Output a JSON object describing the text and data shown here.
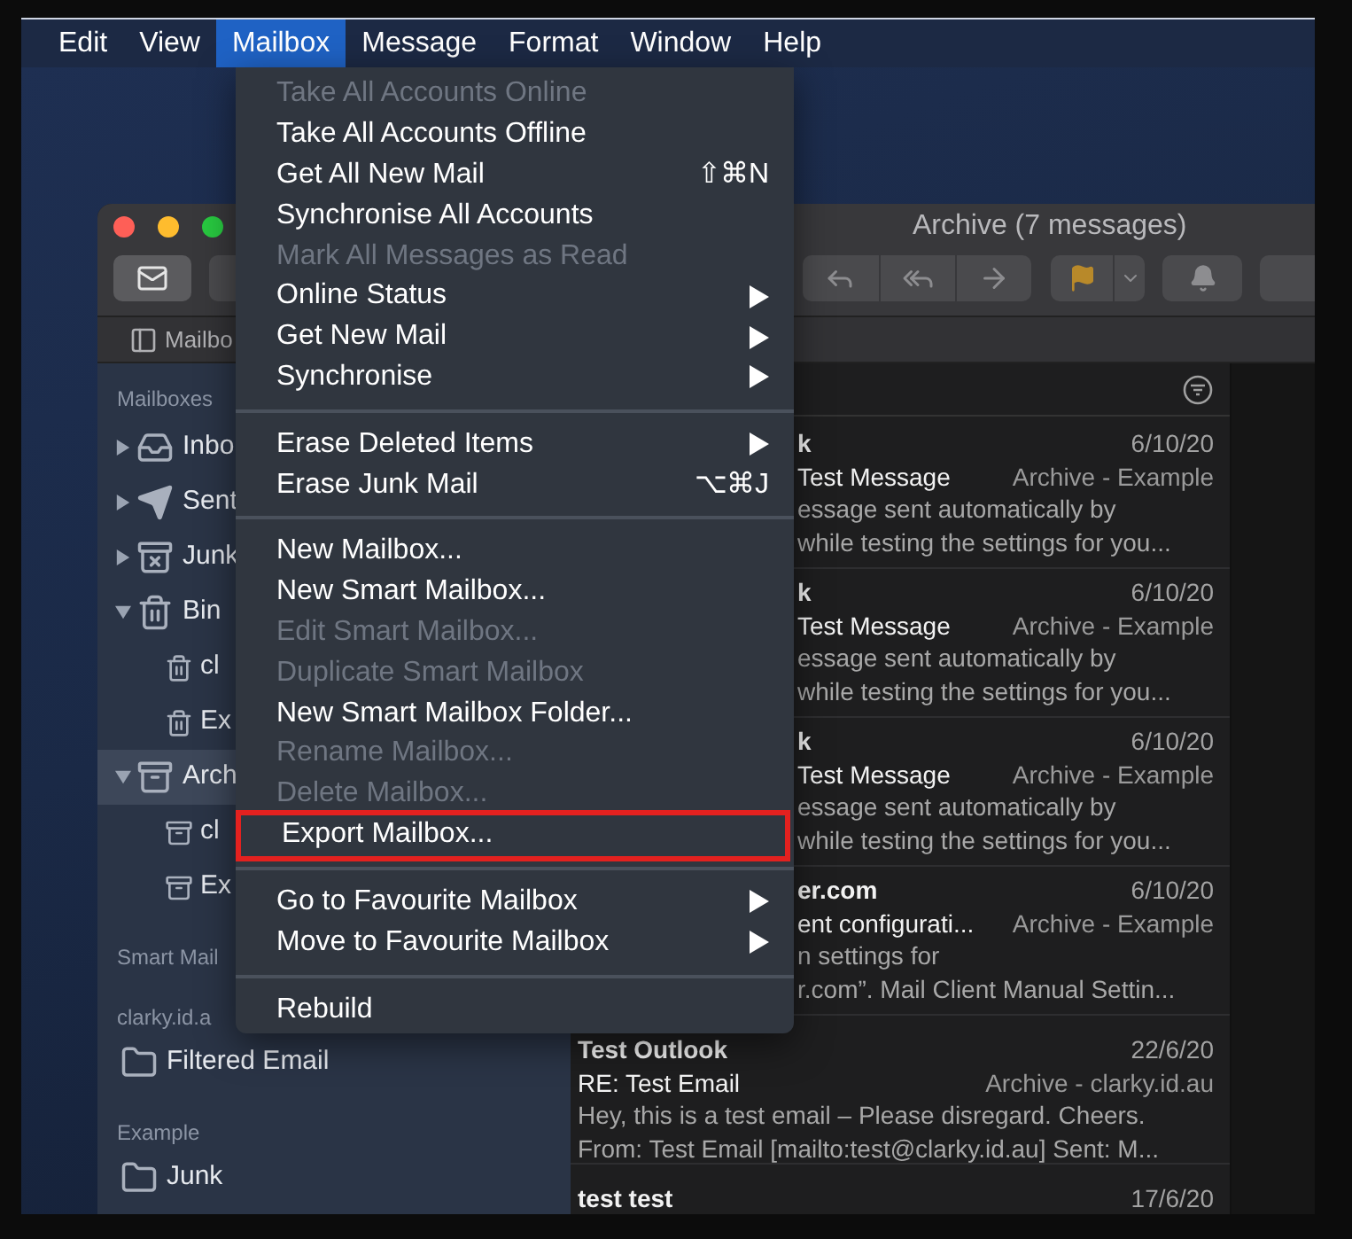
{
  "menu_bar": [
    {
      "label": "Edit",
      "selected": false
    },
    {
      "label": "View",
      "selected": false
    },
    {
      "label": "Mailbox",
      "selected": true
    },
    {
      "label": "Message",
      "selected": false
    },
    {
      "label": "Format",
      "selected": false
    },
    {
      "label": "Window",
      "selected": false
    },
    {
      "label": "Help",
      "selected": false
    }
  ],
  "open_menu": {
    "items": [
      {
        "kind": "item",
        "label": "Take All Accounts Online",
        "disabled": true,
        "submenu": false,
        "highlighted": false
      },
      {
        "kind": "item",
        "label": "Take All Accounts Offline",
        "disabled": false,
        "submenu": false,
        "highlighted": false
      },
      {
        "kind": "item",
        "label": "Get All New Mail",
        "shortcut": "⇧⌘N",
        "disabled": false,
        "submenu": false,
        "highlighted": false
      },
      {
        "kind": "item",
        "label": "Synchronise All Accounts",
        "disabled": false,
        "submenu": false,
        "highlighted": false
      },
      {
        "kind": "item",
        "label": "Mark All Messages as Read",
        "disabled": true,
        "submenu": false,
        "highlighted": false
      },
      {
        "kind": "item",
        "label": "Online Status",
        "disabled": false,
        "submenu": true,
        "highlighted": false
      },
      {
        "kind": "item",
        "label": "Get New Mail",
        "disabled": false,
        "submenu": true,
        "highlighted": false
      },
      {
        "kind": "item",
        "label": "Synchronise",
        "disabled": false,
        "submenu": true,
        "highlighted": false
      },
      {
        "kind": "separator"
      },
      {
        "kind": "item",
        "label": "Erase Deleted Items",
        "disabled": false,
        "submenu": true,
        "highlighted": false
      },
      {
        "kind": "item",
        "label": "Erase Junk Mail",
        "shortcut": "⌥⌘J",
        "disabled": false,
        "submenu": false,
        "highlighted": false
      },
      {
        "kind": "separator"
      },
      {
        "kind": "item",
        "label": "New Mailbox...",
        "disabled": false,
        "submenu": false,
        "highlighted": false
      },
      {
        "kind": "item",
        "label": "New Smart Mailbox...",
        "disabled": false,
        "submenu": false,
        "highlighted": false
      },
      {
        "kind": "item",
        "label": "Edit Smart Mailbox...",
        "disabled": true,
        "submenu": false,
        "highlighted": false
      },
      {
        "kind": "item",
        "label": "Duplicate Smart Mailbox",
        "disabled": true,
        "submenu": false,
        "highlighted": false
      },
      {
        "kind": "item",
        "label": "New Smart Mailbox Folder...",
        "disabled": false,
        "submenu": false,
        "highlighted": false
      },
      {
        "kind": "item",
        "label": "Rename Mailbox...",
        "disabled": true,
        "submenu": false,
        "highlighted": false
      },
      {
        "kind": "item",
        "label": "Delete Mailbox...",
        "disabled": true,
        "submenu": false,
        "highlighted": false
      },
      {
        "kind": "item",
        "label": "Export Mailbox...",
        "disabled": false,
        "submenu": false,
        "highlighted": true
      },
      {
        "kind": "separator"
      },
      {
        "kind": "item",
        "label": "Go to Favourite Mailbox",
        "disabled": false,
        "submenu": true,
        "highlighted": false
      },
      {
        "kind": "item",
        "label": "Move to Favourite Mailbox",
        "disabled": false,
        "submenu": true,
        "highlighted": false
      },
      {
        "kind": "separator"
      },
      {
        "kind": "item",
        "label": "Rebuild",
        "disabled": false,
        "submenu": false,
        "highlighted": false
      }
    ]
  },
  "window": {
    "title": "Archive (7 messages)",
    "favorites_bar": "Mailbo"
  },
  "sidebar": {
    "sections": [
      {
        "header": "Mailboxes",
        "items": [
          {
            "label": "Inbo",
            "kind": "inbox",
            "expanded": false,
            "selected": false
          },
          {
            "label": "Sent",
            "kind": "sent",
            "expanded": false,
            "selected": false
          },
          {
            "label": "Junk",
            "kind": "junk",
            "expanded": false,
            "selected": false
          },
          {
            "label": "Bin",
            "kind": "bin",
            "expanded": true,
            "selected": false,
            "children": [
              {
                "label": "cl",
                "kind": "bin",
                "selected": false
              },
              {
                "label": "Ex",
                "kind": "bin",
                "selected": false
              }
            ]
          },
          {
            "label": "Arch",
            "kind": "archive",
            "expanded": true,
            "selected": true,
            "children": [
              {
                "label": "cl",
                "kind": "archive",
                "selected": false
              },
              {
                "label": "Ex",
                "kind": "archive",
                "selected": false
              }
            ]
          }
        ]
      },
      {
        "header": "Smart Mail"
      },
      {
        "header": "clarky.id.a",
        "items": [
          {
            "label": "Filtered Email",
            "kind": "folder",
            "selected": false
          }
        ]
      },
      {
        "header": "Example",
        "items": [
          {
            "label": "Junk",
            "kind": "folder",
            "selected": false
          }
        ]
      }
    ]
  },
  "message_list": {
    "partly_hidden_rows": [
      {
        "sender": "k",
        "date": "6/10/20",
        "subject": "Test Message",
        "mailbox": "Archive - Example",
        "preview": [
          "essage sent automatically by",
          "while testing the settings for you..."
        ]
      },
      {
        "sender": "k",
        "date": "6/10/20",
        "subject": "Test Message",
        "mailbox": "Archive - Example",
        "preview": [
          "essage sent automatically by",
          "while testing the settings for you..."
        ]
      },
      {
        "sender": "k",
        "date": "6/10/20",
        "subject": "Test Message",
        "mailbox": "Archive - Example",
        "preview": [
          "essage sent automatically by",
          "while testing the settings for you..."
        ]
      },
      {
        "sender": "er.com",
        "date": "6/10/20",
        "subject": "ent configurati...",
        "mailbox": "Archive - Example",
        "preview": [
          "n settings for",
          "r.com”. Mail Client Manual Settin..."
        ]
      }
    ],
    "rows": [
      {
        "sender": "Test Outlook",
        "date": "22/6/20",
        "subject": "RE: Test Email",
        "mailbox": "Archive - clarky.id.au",
        "preview": [
          "Hey, this is a test email – Please disregard. Cheers.",
          "From: Test Email [mailto:test@clarky.id.au] Sent: M..."
        ]
      },
      {
        "sender": "test test",
        "date": "17/6/20"
      }
    ]
  }
}
